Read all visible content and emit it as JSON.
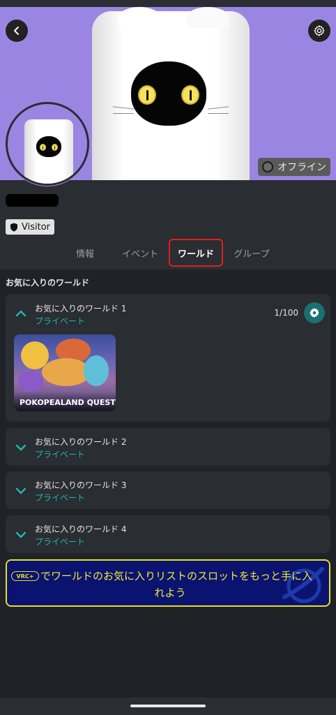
{
  "header": {
    "status": "オフライン",
    "rank": "Visitor"
  },
  "tabs": [
    {
      "label": "情報"
    },
    {
      "label": "イベント"
    },
    {
      "label": "ワールド"
    },
    {
      "label": "グループ"
    }
  ],
  "favorites": {
    "section_title": "お気に入りのワールド",
    "groups": [
      {
        "title": "お気に入りのワールド 1",
        "visibility": "プライベート",
        "count": "1/100",
        "expanded": true,
        "worlds": [
          {
            "name": "POKOPEALAND QUEST"
          }
        ]
      },
      {
        "title": "お気に入りのワールド 2",
        "visibility": "プライベート",
        "expanded": false
      },
      {
        "title": "お気に入りのワールド 3",
        "visibility": "プライベート",
        "expanded": false
      },
      {
        "title": "お気に入りのワールド 4",
        "visibility": "プライベート",
        "expanded": false
      }
    ]
  },
  "promo": {
    "badge": "VRC+",
    "line1": "でワールドのお気に入りリストのスロットをもっと手に入",
    "line2": "れよう"
  },
  "colors": {
    "banner": "#9a86e2",
    "accent_teal": "#1fb6b6",
    "active_tab_outline": "#e02020",
    "promo_bg": "#0b1370",
    "promo_text": "#f0ea3a"
  },
  "icons": [
    "back-icon",
    "settings-gear-icon",
    "offline-status-icon",
    "shield-icon",
    "chevron-up-icon",
    "chevron-down-icon",
    "vrc-plus-logo"
  ]
}
